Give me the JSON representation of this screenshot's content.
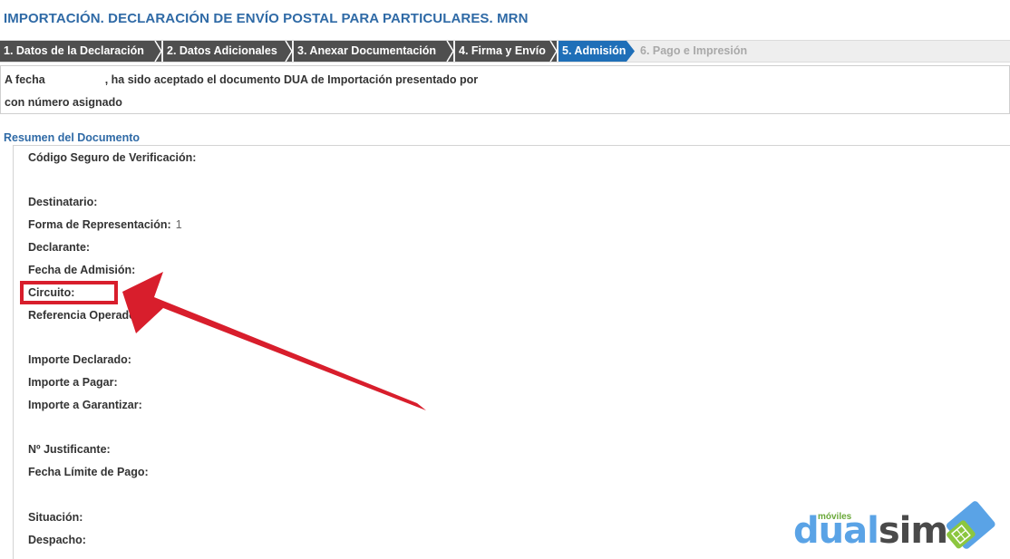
{
  "header": {
    "title": "IMPORTACIÓN. DECLARACIÓN DE ENVÍO POSTAL PARA PARTICULARES. MRN"
  },
  "steps": [
    {
      "label": "1. Datos de la Declaración",
      "state": "done"
    },
    {
      "label": "2. Datos Adicionales",
      "state": "done"
    },
    {
      "label": "3. Anexar Documentación",
      "state": "done"
    },
    {
      "label": "4. Firma y Envío",
      "state": "done"
    },
    {
      "label": "5. Admisión",
      "state": "active"
    },
    {
      "label": "6. Pago e Impresión",
      "state": "disabled"
    }
  ],
  "message": {
    "line1_prefix": "A fecha",
    "line1_suffix": ", ha sido aceptado el documento DUA de Importación presentado por",
    "line2": "con número asignado"
  },
  "summary": {
    "title": "Resumen del Documento",
    "fields": {
      "codigo": "Código Seguro de Verificación:",
      "destinatario": "Destinatario:",
      "forma": "Forma de Representación:",
      "forma_value": "1",
      "declarante": "Declarante:",
      "fecha_admision": "Fecha de Admisión:",
      "circuito": "Circuito:",
      "referencia": "Referencia Operador:",
      "importe_declarado": "Importe Declarado:",
      "importe_pagar": "Importe a Pagar:",
      "importe_garantizar": "Importe a Garantizar:",
      "justificante": "Nº Justificante:",
      "fecha_limite": "Fecha Límite de Pago:",
      "situacion": "Situación:",
      "despacho": "Despacho:"
    }
  },
  "annotation": {
    "color": "#d81e2c",
    "icon": "arrow-pointer"
  },
  "watermark": {
    "small": "móviles",
    "part1": "dual",
    "part2": "sim",
    "icon": "sim-card-icon"
  }
}
